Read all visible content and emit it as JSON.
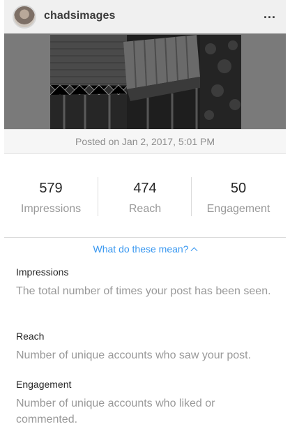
{
  "post": {
    "username": "chadsimages",
    "more_icon": "...",
    "posted_on": "Posted on Jan 2, 2017, 5:01 PM"
  },
  "stats": [
    {
      "value": "579",
      "label": "Impressions"
    },
    {
      "value": "474",
      "label": "Reach"
    },
    {
      "value": "50",
      "label": "Engagement"
    }
  ],
  "explain_link": "What do these mean?",
  "definitions": [
    {
      "term": "Impressions",
      "description": "The total number of times your post has been seen."
    },
    {
      "term": "Reach",
      "description": "Number of unique accounts who saw your post."
    },
    {
      "term": "Engagement",
      "description": "Number of unique accounts who liked or commented."
    }
  ],
  "colors": {
    "link": "#3897f0",
    "muted": "#999999",
    "text": "#262626"
  }
}
